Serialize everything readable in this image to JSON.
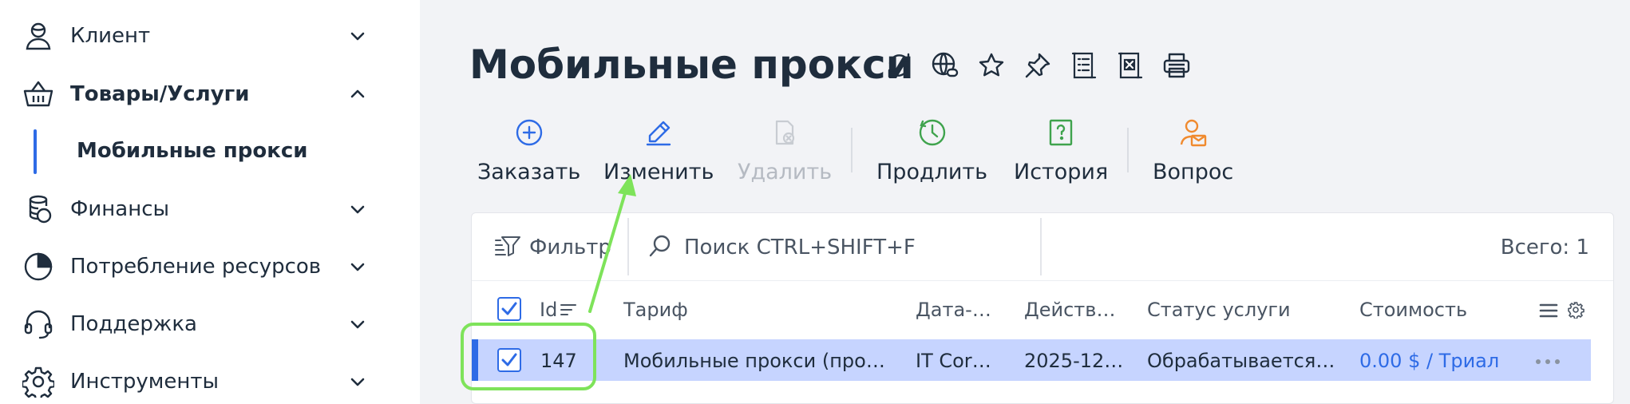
{
  "sidebar": {
    "items": [
      {
        "label": "Клиент",
        "icon": "user-icon",
        "expanded": false
      },
      {
        "label": "Товары/Услуги",
        "icon": "basket-icon",
        "expanded": true
      },
      {
        "label": "Финансы",
        "icon": "coins-icon",
        "expanded": false
      },
      {
        "label": "Потребление ресурсов",
        "icon": "pie-chart-icon",
        "expanded": false
      },
      {
        "label": "Поддержка",
        "icon": "headset-icon",
        "expanded": false
      },
      {
        "label": "Инструменты",
        "icon": "gear-icon",
        "expanded": false
      }
    ],
    "sub_item": {
      "label": "Мобильные прокси"
    }
  },
  "page": {
    "title": "Мобильные прокси",
    "title_icons": [
      "refresh-icon",
      "globe-link-icon",
      "star-icon",
      "pin-icon",
      "list-doc-icon",
      "excel-doc-icon",
      "printer-icon"
    ]
  },
  "toolbar": {
    "order": "Заказать",
    "edit": "Изменить",
    "delete": "Удалить",
    "extend": "Продлить",
    "history": "История",
    "question": "Вопрос"
  },
  "table": {
    "filter_label": "Фильтр",
    "search_placeholder": "Поиск CTRL+SHIFT+F",
    "total": "Всего: 1",
    "columns": {
      "id": "Id",
      "tariff": "Тариф",
      "datacenter": "Дата-ц...",
      "valid": "Действу...",
      "status": "Статус услуги",
      "cost": "Стоимость"
    },
    "rows": [
      {
        "id": "147",
        "tariff": "Мобильные прокси (пробн...",
        "datacenter": "IT Corv...",
        "valid": "2025-12-...",
        "status": "Обрабатывается (...",
        "cost": "0.00 $ / Триал",
        "selected": true
      }
    ]
  },
  "colors": {
    "accent": "#2e6be6",
    "row_selected": "#c6d4ff",
    "annotation": "#7ee35a",
    "history_icon": "#3fa34d",
    "question_icon": "#f08a2e"
  }
}
